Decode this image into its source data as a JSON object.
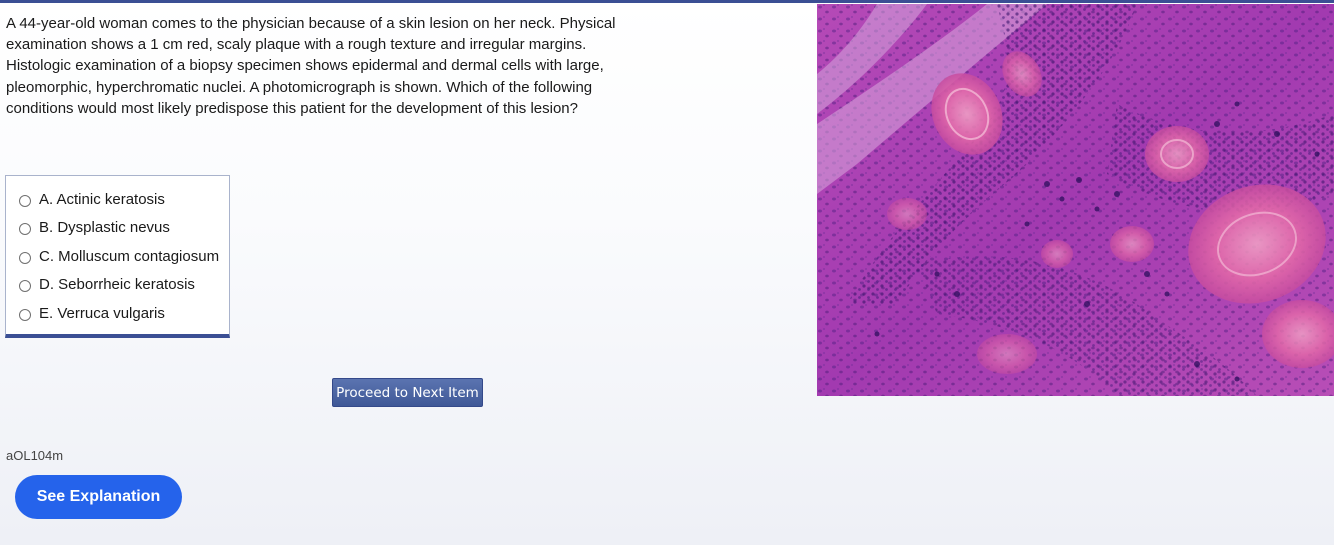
{
  "question": {
    "stem": "A 44-year-old woman comes to the physician because of a skin lesion on her neck. Physical examination shows a 1 cm red, scaly plaque with a rough texture and irregular margins. Histologic examination of a biopsy specimen shows epidermal and dermal cells with large, pleomorphic, hyperchromatic nuclei. A photomicrograph is shown. Which of the following conditions would most likely predispose this patient for the development of this lesion?",
    "id": "aOL104m"
  },
  "answers": [
    {
      "label": "A. Actinic keratosis"
    },
    {
      "label": "B. Dysplastic nevus"
    },
    {
      "label": "C. Molluscum contagiosum"
    },
    {
      "label": "D. Seborrheic keratosis"
    },
    {
      "label": "E. Verruca vulgaris"
    }
  ],
  "buttons": {
    "proceed_label": "Proceed to Next Item",
    "explanation_label": "See Explanation"
  },
  "colors": {
    "accent": "#3b4f94",
    "explanation_button": "#2563eb",
    "micrograph_base": "#a03fb0"
  }
}
